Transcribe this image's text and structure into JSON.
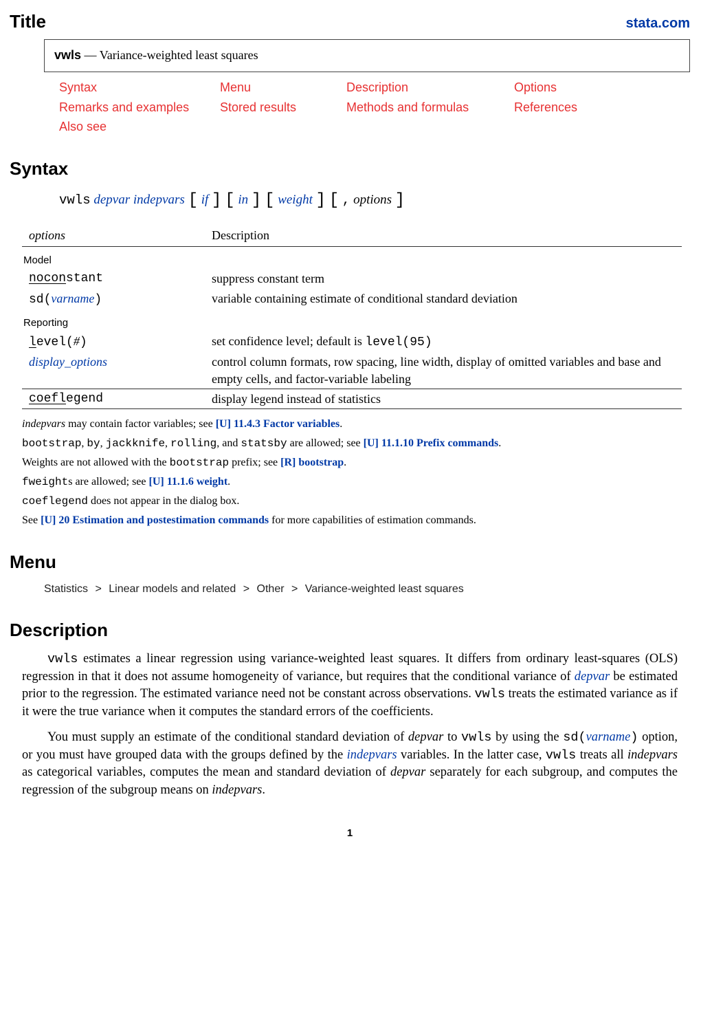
{
  "header": {
    "title_label": "Title",
    "brand": "stata.com"
  },
  "title_box": {
    "command": "vwls",
    "dash": "—",
    "desc": "Variance-weighted least squares"
  },
  "toc": {
    "syntax": "Syntax",
    "menu": "Menu",
    "description": "Description",
    "options": "Options",
    "remarks": "Remarks and examples",
    "stored": "Stored results",
    "methods": "Methods and formulas",
    "references": "References",
    "also_see": "Also see"
  },
  "sections": {
    "syntax": "Syntax",
    "menu": "Menu",
    "description": "Description"
  },
  "syntax_line": {
    "cmd": "vwls",
    "depvar": "depvar",
    "indepvars": "indepvars",
    "if": "if",
    "in": "in",
    "weight": "weight",
    "comma": ",",
    "options": "options"
  },
  "options_table": {
    "head_option": "options",
    "head_desc": "Description",
    "group_model": "Model",
    "group_reporting": "Reporting",
    "rows": {
      "noconstant": {
        "under": "nocon",
        "rest": "stant",
        "desc": "suppress constant term"
      },
      "sd": {
        "label_pre": "sd(",
        "varname": "varname",
        "label_post": ")",
        "desc": "variable containing estimate of conditional standard deviation"
      },
      "level": {
        "under": "l",
        "rest": "evel(",
        "arg": "#",
        "close": ")",
        "desc_pre": "set confidence level; default is ",
        "default": "level(95)"
      },
      "display_options": {
        "label": "display_options",
        "desc": "control column formats, row spacing, line width, display of omitted variables and base and empty cells, and factor-variable labeling"
      },
      "coeflegend": {
        "under": "coefl",
        "rest": "egend",
        "desc": "display legend instead of statistics"
      }
    }
  },
  "notes": {
    "n1a_it": "indepvars",
    "n1a": " may contain factor variables; see ",
    "n1link": "[U] 11.4.3 Factor variables",
    "n1b": ".",
    "n2a": "bootstrap",
    "n2b": ", ",
    "n2c": "by",
    "n2d": ", ",
    "n2e": "jackknife",
    "n2f": ", ",
    "n2g": "rolling",
    "n2h": ", and ",
    "n2i": "statsby",
    "n2j": " are allowed; see ",
    "n2link": "[U] 11.1.10 Prefix commands",
    "n2k": ".",
    "n3a": "Weights are not allowed with the ",
    "n3b": "bootstrap",
    "n3c": " prefix; see ",
    "n3link": "[R] bootstrap",
    "n3d": ".",
    "n4a": "fweight",
    "n4b": "s are allowed; see ",
    "n4link": "[U] 11.1.6 weight",
    "n4c": ".",
    "n5a": "coeflegend",
    "n5b": " does not appear in the dialog box.",
    "n6a": "See ",
    "n6link": "[U] 20 Estimation and postestimation commands",
    "n6b": " for more capabilities of estimation commands."
  },
  "menu_path": {
    "a": "Statistics",
    "b": "Linear models and related",
    "c": "Other",
    "d": "Variance-weighted least squares"
  },
  "description_paragraphs": {
    "p1_a": "vwls",
    "p1_b": " estimates a linear regression using variance-weighted least squares. It differs from ordinary least-squares (",
    "p1_ols": "OLS",
    "p1_c": ") regression in that it does not assume homogeneity of variance, but requires that the conditional variance of ",
    "p1_depvar": "depvar",
    "p1_d": " be estimated prior to the regression. The estimated variance need not be constant across observations. ",
    "p1_e": "vwls",
    "p1_f": " treats the estimated variance as if it were the true variance when it computes the standard errors of the coefficients.",
    "p2_a": "You must supply an estimate of the conditional standard deviation of ",
    "p2_depvar": "depvar",
    "p2_b": " to ",
    "p2_c": "vwls",
    "p2_d": " by using the ",
    "p2_e": "sd(",
    "p2_varname": "varname",
    "p2_f": ")",
    "p2_g": " option, or you must have grouped data with the groups defined by the ",
    "p2_indepvars": "indepvars",
    "p2_h": " variables. In the latter case, ",
    "p2_i": "vwls",
    "p2_j": " treats all ",
    "p2_k": "indepvars",
    "p2_l": " as categorical variables, computes the mean and standard deviation of ",
    "p2_m": "depvar",
    "p2_n": " separately for each subgroup, and computes the regression of the subgroup means on ",
    "p2_o": "indepvars",
    "p2_p": "."
  },
  "page_number": "1"
}
